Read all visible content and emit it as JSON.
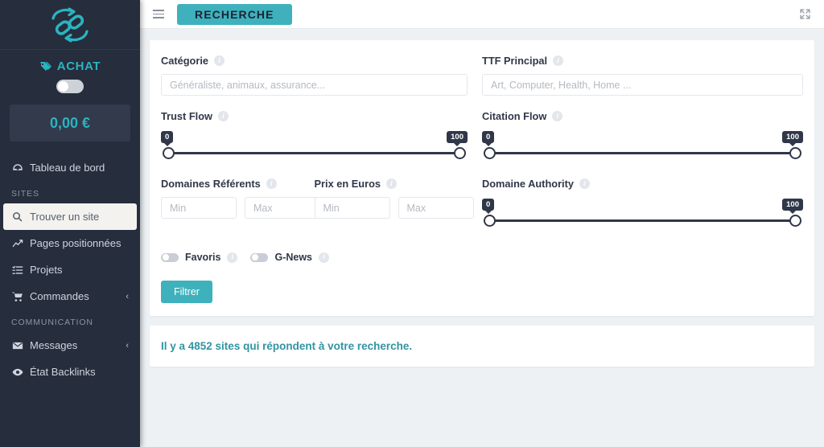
{
  "sidebar": {
    "logo_icon": "link-refresh-logo",
    "achat": {
      "icon": "tag-icon",
      "label": "ACHAT",
      "toggle_state": "off"
    },
    "balance": "0,00 €",
    "items": [
      {
        "icon": "dashboard-speedometer-icon",
        "label": "Tableau de bord",
        "type": "item",
        "active": false,
        "caret": ""
      },
      {
        "label": "SITES",
        "type": "section"
      },
      {
        "icon": "search-icon",
        "label": "Trouver un site",
        "type": "item",
        "active": true,
        "caret": ""
      },
      {
        "icon": "chart-line-icon",
        "label": "Pages positionnées",
        "type": "item",
        "active": false,
        "caret": ""
      },
      {
        "icon": "list-tasks-icon",
        "label": "Projets",
        "type": "item",
        "active": false,
        "caret": ""
      },
      {
        "icon": "shopping-cart-icon",
        "label": "Commandes",
        "type": "item",
        "active": false,
        "caret": "‹"
      },
      {
        "label": "COMMUNICATION",
        "type": "section"
      },
      {
        "icon": "envelope-icon",
        "label": "Messages",
        "type": "item",
        "active": false,
        "caret": "‹"
      },
      {
        "icon": "eye-icon",
        "label": "État Backlinks",
        "type": "item",
        "active": false,
        "caret": ""
      }
    ]
  },
  "topbar": {
    "menu_icon": "hamburger-icon",
    "page_chip": "RECHERCHE",
    "expand_icon": "fullscreen-expand-icon"
  },
  "filters": {
    "categorie": {
      "label": "Catégorie",
      "placeholder": "Généraliste, animaux, assurance...",
      "value": "",
      "info_icon": "info-icon"
    },
    "ttf_principal": {
      "label": "TTF Principal",
      "placeholder": "Art, Computer, Health, Home ...",
      "value": "",
      "info_icon": "info-icon"
    },
    "trust_flow": {
      "label": "Trust Flow",
      "min": "0",
      "max": "100",
      "info_icon": "info-icon"
    },
    "citation_flow": {
      "label": "Citation Flow",
      "min": "0",
      "max": "100",
      "info_icon": "info-icon"
    },
    "domaines_referents": {
      "label": "Domaines Référents",
      "min_placeholder": "Min",
      "max_placeholder": "Max",
      "min_value": "",
      "max_value": "",
      "info_icon": "info-icon"
    },
    "prix_en_euros": {
      "label": "Prix en Euros",
      "min_placeholder": "Min",
      "max_placeholder": "Max",
      "min_value": "",
      "max_value": "",
      "info_icon": "info-icon"
    },
    "domaine_authority": {
      "label": "Domaine Authority",
      "min": "0",
      "max": "100",
      "info_icon": "info-icon"
    },
    "favoris": {
      "label": "Favoris",
      "state": "off",
      "info_icon": "info-icon"
    },
    "gnews": {
      "label": "G-News",
      "state": "off",
      "info_icon": "info-icon"
    },
    "submit_label": "Filtrer"
  },
  "results": {
    "text": "Il y a 4852 sites qui répondent à votre recherche."
  },
  "colors": {
    "accent": "#3eb1bd",
    "sidebar_bg": "#262d3d",
    "page_bg": "#eef1f4",
    "slider_dark": "#2f3748",
    "results_text": "#3194a3"
  }
}
